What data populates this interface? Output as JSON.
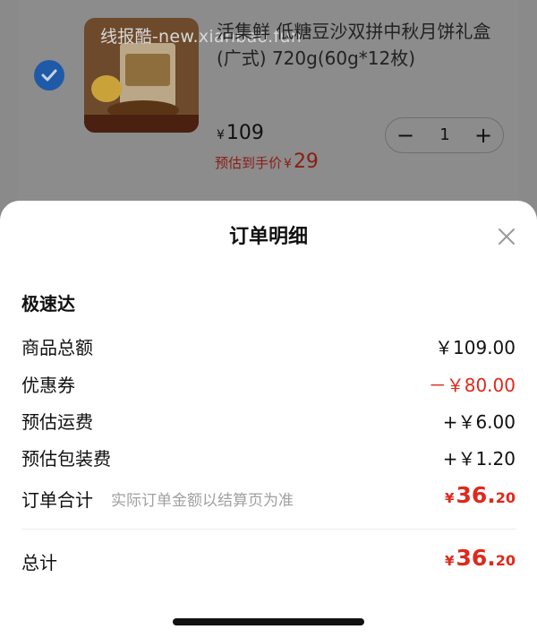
{
  "product": {
    "watermark": "线报酷-new.xianbao.fun",
    "title": "活集鲜 低糖豆沙双拼中秋月饼礼盒(广式) 720g(60g*12枚)",
    "currency": "¥",
    "price": "109",
    "estimate_label": "预估到手价",
    "estimate_value": "29",
    "quantity": "1",
    "minus_label": "−",
    "plus_label": "+"
  },
  "sheet": {
    "title": "订单明细",
    "section": "极速达",
    "rows": [
      {
        "label": "商品总额",
        "value": "￥109.00"
      },
      {
        "label": "优惠券",
        "value": "－￥80.00"
      },
      {
        "label": "预估运费",
        "value": "+￥6.00"
      },
      {
        "label": "预估包装费",
        "value": "+￥1.20"
      }
    ],
    "order_total": {
      "label": "订单合计",
      "note": "实际订单金额以结算页为准",
      "currency": "¥",
      "int": "36.",
      "dec": "20"
    },
    "grand_total": {
      "label": "总计",
      "currency": "¥",
      "int": "36.",
      "dec": "20"
    }
  },
  "colors": {
    "accent_red": "#e0291c",
    "checkbox_blue": "#1f5aa8"
  },
  "icons": [
    "checkmark-icon",
    "close-icon"
  ]
}
